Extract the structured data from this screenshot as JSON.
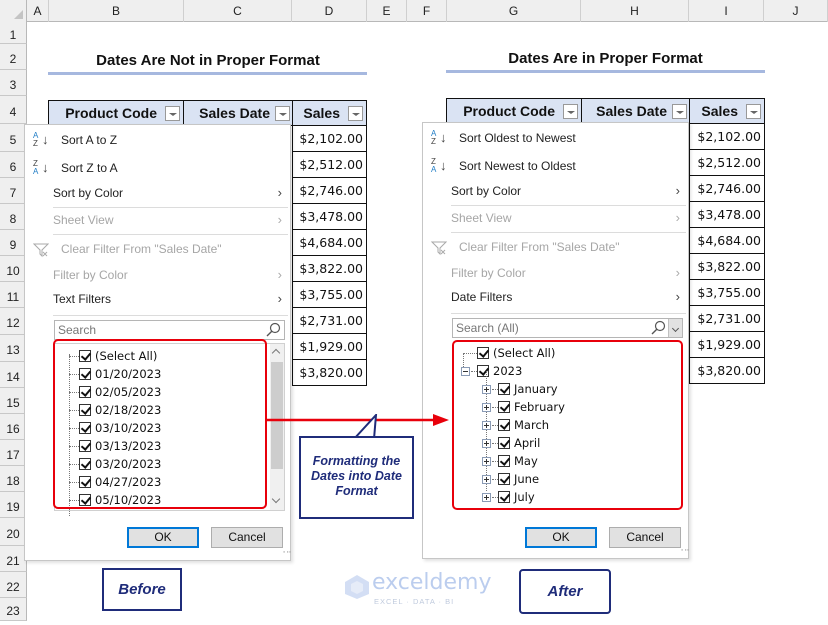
{
  "columns": [
    "A",
    "B",
    "C",
    "D",
    "E",
    "F",
    "G",
    "H",
    "I",
    "J"
  ],
  "rows": [
    "1",
    "2",
    "3",
    "4",
    "5",
    "6",
    "7",
    "8",
    "9",
    "10",
    "11",
    "12",
    "13",
    "14",
    "15",
    "16",
    "17",
    "18",
    "19",
    "20",
    "21",
    "22",
    "23"
  ],
  "left": {
    "title": "Dates Are Not in Proper Format",
    "headers": [
      "Product Code",
      "Sales Date",
      "Sales"
    ],
    "sales": [
      "$2,102.00",
      "$2,512.00",
      "$2,746.00",
      "$3,478.00",
      "$4,684.00",
      "$3,822.00",
      "$3,755.00",
      "$2,731.00",
      "$1,929.00",
      "$3,820.00"
    ],
    "menu": {
      "sort_asc": "Sort A to Z",
      "sort_desc": "Sort Z to A",
      "sort_by_color": "Sort by Color",
      "sheet_view": "Sheet View",
      "clear_filter": "Clear Filter From \"Sales Date\"",
      "filter_by_color": "Filter by Color",
      "type_filters": "Text Filters",
      "search_placeholder": "Search",
      "items": [
        "(Select All)",
        "01/20/2023",
        "02/05/2023",
        "02/18/2023",
        "03/10/2023",
        "03/13/2023",
        "03/20/2023",
        "04/27/2023",
        "05/10/2023"
      ],
      "ok": "OK",
      "cancel": "Cancel"
    },
    "caption": "Before"
  },
  "right": {
    "title": "Dates Are in Proper Format",
    "headers": [
      "Product Code",
      "Sales Date",
      "Sales"
    ],
    "sales": [
      "$2,102.00",
      "$2,512.00",
      "$2,746.00",
      "$3,478.00",
      "$4,684.00",
      "$3,822.00",
      "$3,755.00",
      "$2,731.00",
      "$1,929.00",
      "$3,820.00"
    ],
    "menu": {
      "sort_asc": "Sort Oldest to Newest",
      "sort_desc": "Sort Newest to Oldest",
      "sort_by_color": "Sort by Color",
      "sheet_view": "Sheet View",
      "clear_filter": "Clear Filter From \"Sales Date\"",
      "filter_by_color": "Filter by Color",
      "type_filters": "Date Filters",
      "search_placeholder": "Search (All)",
      "select_all": "(Select All)",
      "year": "2023",
      "months": [
        "January",
        "February",
        "March",
        "April",
        "May",
        "June",
        "July"
      ],
      "ok": "OK",
      "cancel": "Cancel"
    },
    "caption": "After"
  },
  "callout": "Formatting the Dates into Date Format",
  "watermark": {
    "name": "exceldemy",
    "tagline": "EXCEL · DATA · BI"
  },
  "colors": {
    "highlight_red": "#e8000b",
    "navy": "#1f2c7a",
    "header_fill": "#dae3f3",
    "accent_blue": "#1f7cc5"
  }
}
